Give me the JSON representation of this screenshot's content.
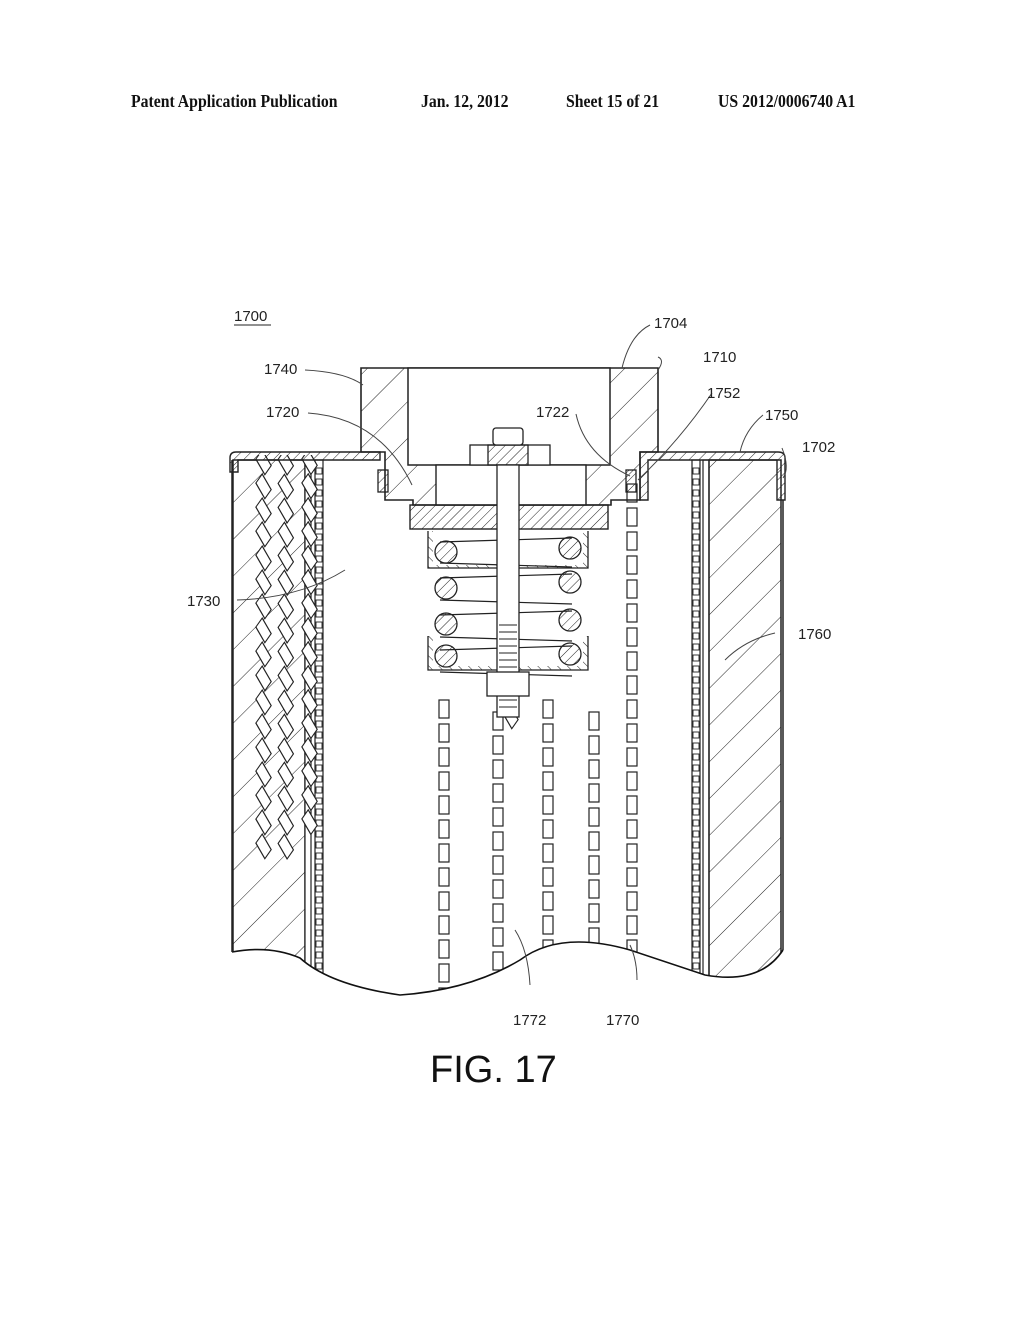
{
  "header": {
    "publication_type": "Patent Application Publication",
    "date": "Jan. 12, 2012",
    "sheet": "Sheet 15 of 21",
    "publication_number": "US 2012/0006740 A1"
  },
  "figure": {
    "caption": "FIG. 17",
    "assembly_label": "1700",
    "reference_numerals": {
      "r1702": "1702",
      "r1704": "1704",
      "r1710": "1710",
      "r1720": "1720",
      "r1722": "1722",
      "r1730": "1730",
      "r1740": "1740",
      "r1750": "1750",
      "r1752": "1752",
      "r1760": "1760",
      "r1770": "1770",
      "r1772": "1772"
    }
  }
}
